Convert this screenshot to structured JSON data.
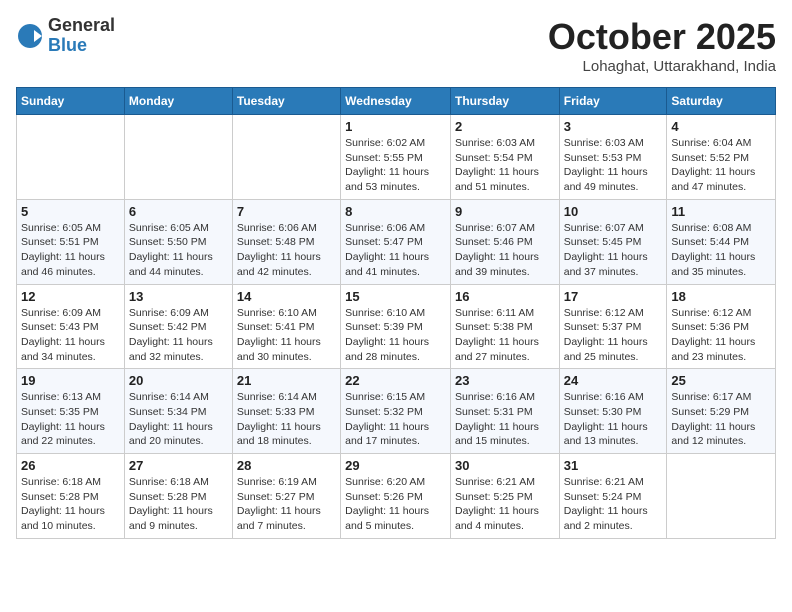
{
  "logo": {
    "general": "General",
    "blue": "Blue"
  },
  "title": "October 2025",
  "location": "Lohaghat, Uttarakhand, India",
  "header_days": [
    "Sunday",
    "Monday",
    "Tuesday",
    "Wednesday",
    "Thursday",
    "Friday",
    "Saturday"
  ],
  "weeks": [
    [
      {
        "day": "",
        "sunrise": "",
        "sunset": "",
        "daylight": ""
      },
      {
        "day": "",
        "sunrise": "",
        "sunset": "",
        "daylight": ""
      },
      {
        "day": "",
        "sunrise": "",
        "sunset": "",
        "daylight": ""
      },
      {
        "day": "1",
        "sunrise": "Sunrise: 6:02 AM",
        "sunset": "Sunset: 5:55 PM",
        "daylight": "Daylight: 11 hours and 53 minutes."
      },
      {
        "day": "2",
        "sunrise": "Sunrise: 6:03 AM",
        "sunset": "Sunset: 5:54 PM",
        "daylight": "Daylight: 11 hours and 51 minutes."
      },
      {
        "day": "3",
        "sunrise": "Sunrise: 6:03 AM",
        "sunset": "Sunset: 5:53 PM",
        "daylight": "Daylight: 11 hours and 49 minutes."
      },
      {
        "day": "4",
        "sunrise": "Sunrise: 6:04 AM",
        "sunset": "Sunset: 5:52 PM",
        "daylight": "Daylight: 11 hours and 47 minutes."
      }
    ],
    [
      {
        "day": "5",
        "sunrise": "Sunrise: 6:05 AM",
        "sunset": "Sunset: 5:51 PM",
        "daylight": "Daylight: 11 hours and 46 minutes."
      },
      {
        "day": "6",
        "sunrise": "Sunrise: 6:05 AM",
        "sunset": "Sunset: 5:50 PM",
        "daylight": "Daylight: 11 hours and 44 minutes."
      },
      {
        "day": "7",
        "sunrise": "Sunrise: 6:06 AM",
        "sunset": "Sunset: 5:48 PM",
        "daylight": "Daylight: 11 hours and 42 minutes."
      },
      {
        "day": "8",
        "sunrise": "Sunrise: 6:06 AM",
        "sunset": "Sunset: 5:47 PM",
        "daylight": "Daylight: 11 hours and 41 minutes."
      },
      {
        "day": "9",
        "sunrise": "Sunrise: 6:07 AM",
        "sunset": "Sunset: 5:46 PM",
        "daylight": "Daylight: 11 hours and 39 minutes."
      },
      {
        "day": "10",
        "sunrise": "Sunrise: 6:07 AM",
        "sunset": "Sunset: 5:45 PM",
        "daylight": "Daylight: 11 hours and 37 minutes."
      },
      {
        "day": "11",
        "sunrise": "Sunrise: 6:08 AM",
        "sunset": "Sunset: 5:44 PM",
        "daylight": "Daylight: 11 hours and 35 minutes."
      }
    ],
    [
      {
        "day": "12",
        "sunrise": "Sunrise: 6:09 AM",
        "sunset": "Sunset: 5:43 PM",
        "daylight": "Daylight: 11 hours and 34 minutes."
      },
      {
        "day": "13",
        "sunrise": "Sunrise: 6:09 AM",
        "sunset": "Sunset: 5:42 PM",
        "daylight": "Daylight: 11 hours and 32 minutes."
      },
      {
        "day": "14",
        "sunrise": "Sunrise: 6:10 AM",
        "sunset": "Sunset: 5:41 PM",
        "daylight": "Daylight: 11 hours and 30 minutes."
      },
      {
        "day": "15",
        "sunrise": "Sunrise: 6:10 AM",
        "sunset": "Sunset: 5:39 PM",
        "daylight": "Daylight: 11 hours and 28 minutes."
      },
      {
        "day": "16",
        "sunrise": "Sunrise: 6:11 AM",
        "sunset": "Sunset: 5:38 PM",
        "daylight": "Daylight: 11 hours and 27 minutes."
      },
      {
        "day": "17",
        "sunrise": "Sunrise: 6:12 AM",
        "sunset": "Sunset: 5:37 PM",
        "daylight": "Daylight: 11 hours and 25 minutes."
      },
      {
        "day": "18",
        "sunrise": "Sunrise: 6:12 AM",
        "sunset": "Sunset: 5:36 PM",
        "daylight": "Daylight: 11 hours and 23 minutes."
      }
    ],
    [
      {
        "day": "19",
        "sunrise": "Sunrise: 6:13 AM",
        "sunset": "Sunset: 5:35 PM",
        "daylight": "Daylight: 11 hours and 22 minutes."
      },
      {
        "day": "20",
        "sunrise": "Sunrise: 6:14 AM",
        "sunset": "Sunset: 5:34 PM",
        "daylight": "Daylight: 11 hours and 20 minutes."
      },
      {
        "day": "21",
        "sunrise": "Sunrise: 6:14 AM",
        "sunset": "Sunset: 5:33 PM",
        "daylight": "Daylight: 11 hours and 18 minutes."
      },
      {
        "day": "22",
        "sunrise": "Sunrise: 6:15 AM",
        "sunset": "Sunset: 5:32 PM",
        "daylight": "Daylight: 11 hours and 17 minutes."
      },
      {
        "day": "23",
        "sunrise": "Sunrise: 6:16 AM",
        "sunset": "Sunset: 5:31 PM",
        "daylight": "Daylight: 11 hours and 15 minutes."
      },
      {
        "day": "24",
        "sunrise": "Sunrise: 6:16 AM",
        "sunset": "Sunset: 5:30 PM",
        "daylight": "Daylight: 11 hours and 13 minutes."
      },
      {
        "day": "25",
        "sunrise": "Sunrise: 6:17 AM",
        "sunset": "Sunset: 5:29 PM",
        "daylight": "Daylight: 11 hours and 12 minutes."
      }
    ],
    [
      {
        "day": "26",
        "sunrise": "Sunrise: 6:18 AM",
        "sunset": "Sunset: 5:28 PM",
        "daylight": "Daylight: 11 hours and 10 minutes."
      },
      {
        "day": "27",
        "sunrise": "Sunrise: 6:18 AM",
        "sunset": "Sunset: 5:28 PM",
        "daylight": "Daylight: 11 hours and 9 minutes."
      },
      {
        "day": "28",
        "sunrise": "Sunrise: 6:19 AM",
        "sunset": "Sunset: 5:27 PM",
        "daylight": "Daylight: 11 hours and 7 minutes."
      },
      {
        "day": "29",
        "sunrise": "Sunrise: 6:20 AM",
        "sunset": "Sunset: 5:26 PM",
        "daylight": "Daylight: 11 hours and 5 minutes."
      },
      {
        "day": "30",
        "sunrise": "Sunrise: 6:21 AM",
        "sunset": "Sunset: 5:25 PM",
        "daylight": "Daylight: 11 hours and 4 minutes."
      },
      {
        "day": "31",
        "sunrise": "Sunrise: 6:21 AM",
        "sunset": "Sunset: 5:24 PM",
        "daylight": "Daylight: 11 hours and 2 minutes."
      },
      {
        "day": "",
        "sunrise": "",
        "sunset": "",
        "daylight": ""
      }
    ]
  ]
}
